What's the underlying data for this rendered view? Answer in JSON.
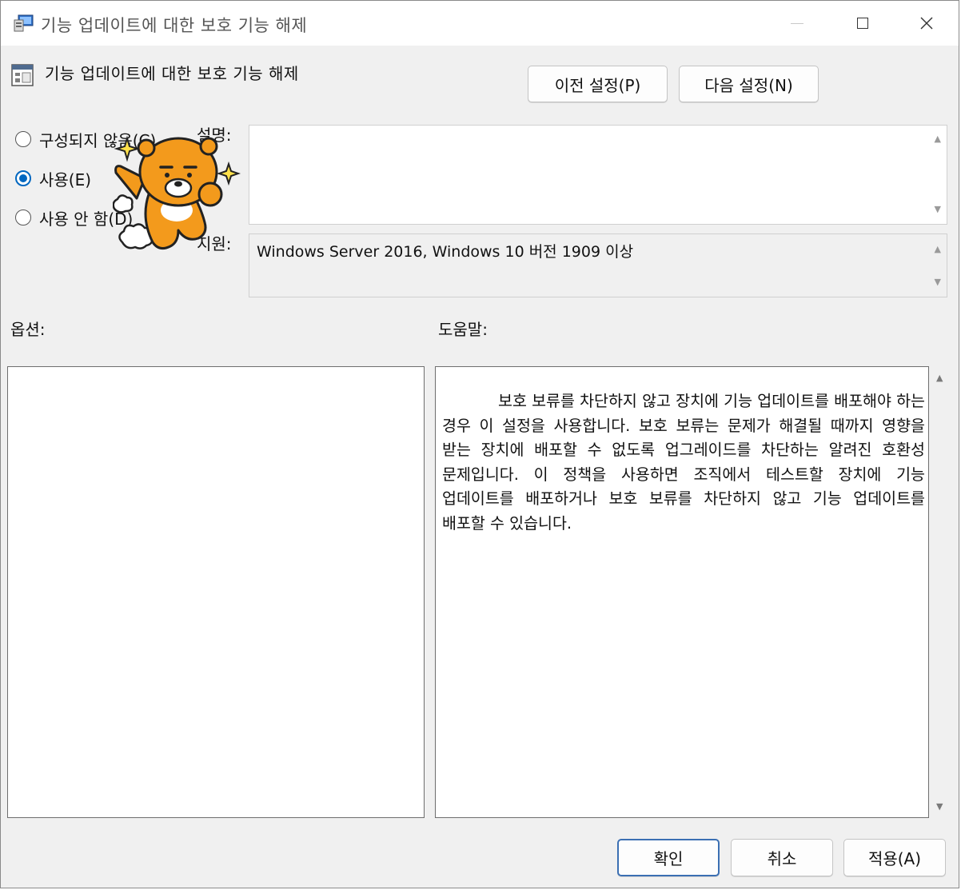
{
  "window": {
    "title": "기능 업데이트에 대한 보호 기능 해제"
  },
  "policy": {
    "title": "기능 업데이트에 대한 보호 기능 해제"
  },
  "nav": {
    "prev_label": "이전 설정(P)",
    "next_label": "다음 설정(N)"
  },
  "radios": [
    {
      "label": "구성되지 않음(C)",
      "checked": false
    },
    {
      "label": "사용(E)",
      "checked": true
    },
    {
      "label": "사용 안 함(D)",
      "checked": false
    }
  ],
  "comment": {
    "label": "설명:",
    "value": ""
  },
  "supported": {
    "label": "지원:",
    "value": "Windows Server 2016, Windows 10 버전 1909 이상"
  },
  "options": {
    "label": "옵션:"
  },
  "help": {
    "label": "도움말:",
    "text": "보호 보류를 차단하지 않고 장치에 기능 업데이트를 배포해야 하는 경우 이 설정을 사용합니다. 보호 보류는 문제가 해결될 때까지 영향을 받는 장치에 배포할 수 없도록 업그레이드를 차단하는 알려진 호환성 문제입니다. 이 정책을 사용하면 조직에서 테스트할 장치에 기능 업데이트를 배포하거나 보호 보류를 차단하지 않고 기능 업데이트를 배포할 수 있습니다."
  },
  "footer": {
    "ok_label": "확인",
    "cancel_label": "취소",
    "apply_label": "적용(A)"
  },
  "colors": {
    "accent": "#0067c0",
    "mascot": "#f39a1c"
  }
}
